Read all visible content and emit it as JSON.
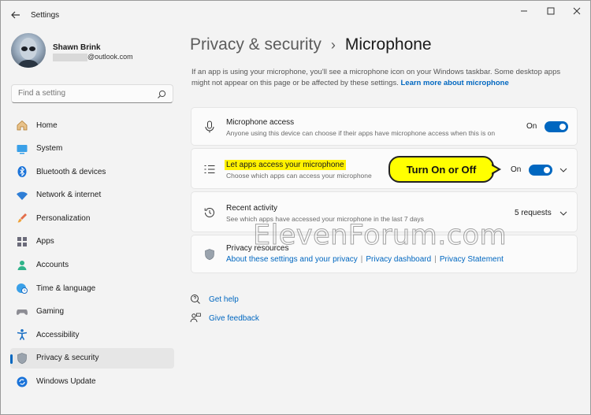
{
  "window": {
    "title": "Settings"
  },
  "profile": {
    "name": "Shawn Brink",
    "email": "@outlook.com"
  },
  "search": {
    "placeholder": "Find a setting"
  },
  "nav": [
    {
      "id": "home",
      "label": "Home",
      "icon": "home-icon"
    },
    {
      "id": "system",
      "label": "System",
      "icon": "system-icon"
    },
    {
      "id": "bluetooth",
      "label": "Bluetooth & devices",
      "icon": "bluetooth-icon"
    },
    {
      "id": "network",
      "label": "Network & internet",
      "icon": "wifi-icon"
    },
    {
      "id": "personalization",
      "label": "Personalization",
      "icon": "brush-icon"
    },
    {
      "id": "apps",
      "label": "Apps",
      "icon": "apps-icon"
    },
    {
      "id": "accounts",
      "label": "Accounts",
      "icon": "accounts-icon"
    },
    {
      "id": "time",
      "label": "Time & language",
      "icon": "globe-clock-icon"
    },
    {
      "id": "gaming",
      "label": "Gaming",
      "icon": "gamepad-icon"
    },
    {
      "id": "accessibility",
      "label": "Accessibility",
      "icon": "accessibility-icon"
    },
    {
      "id": "privacy",
      "label": "Privacy & security",
      "icon": "shield-icon",
      "active": true
    },
    {
      "id": "update",
      "label": "Windows Update",
      "icon": "update-icon"
    }
  ],
  "page": {
    "parent": "Privacy & security",
    "separator": "›",
    "current": "Microphone",
    "intro_text": "If an app is using your microphone, you'll see a microphone icon on your Windows taskbar. Some desktop apps might not appear on this page or be affected by these settings.",
    "intro_link": "Learn more about microphone"
  },
  "settings": {
    "mic_access": {
      "title": "Microphone access",
      "desc": "Anyone using this device can choose if their apps have microphone access when this is on",
      "state": "On"
    },
    "apps_access": {
      "title": "Let apps access your microphone",
      "desc": "Choose which apps can access your microphone",
      "state": "On"
    },
    "recent": {
      "title": "Recent activity",
      "desc": "See which apps have accessed your microphone in the last 7 days",
      "value": "5 requests"
    },
    "resources": {
      "title": "Privacy resources",
      "links": [
        "About these settings and your privacy",
        "Privacy dashboard",
        "Privacy Statement"
      ]
    }
  },
  "callout": {
    "text": "Turn On or Off"
  },
  "help": {
    "get_help": "Get help",
    "feedback": "Give feedback"
  },
  "watermark": "ElevenForum.com",
  "colors": {
    "accent": "#0067c0",
    "highlight": "#fff200",
    "callout": "#ffff00"
  }
}
